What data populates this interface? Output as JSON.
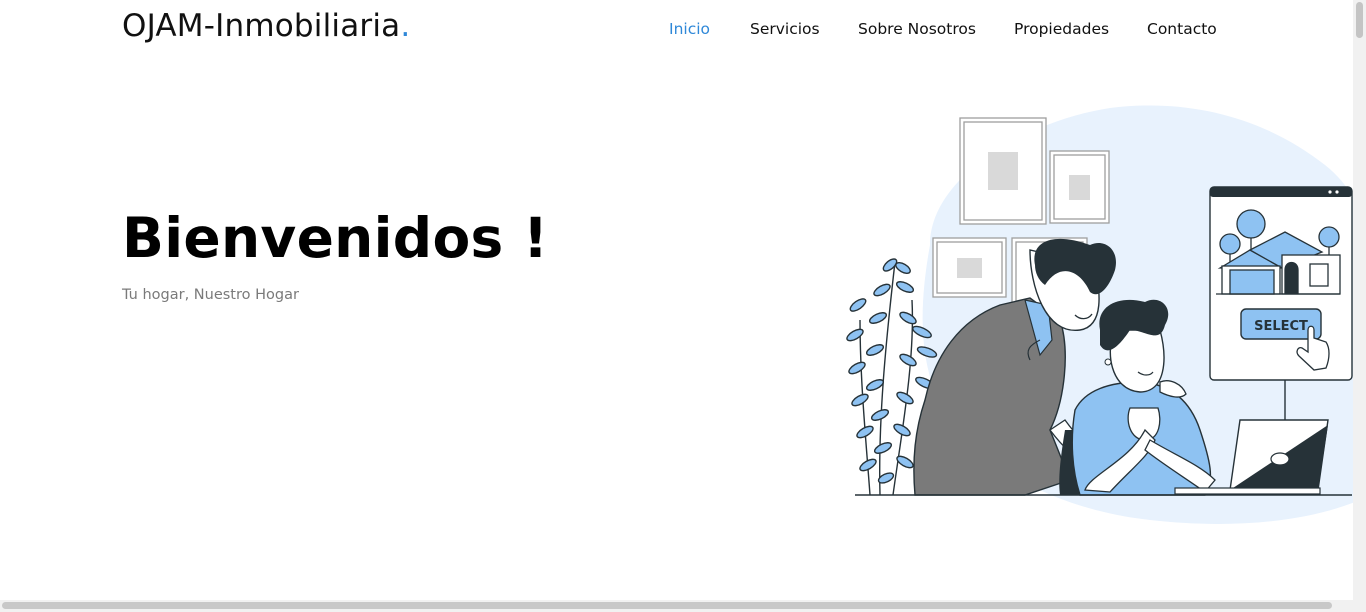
{
  "brand": {
    "name": "OJAM-Inmobiliaria",
    "dot": "."
  },
  "nav": [
    {
      "label": "Inicio",
      "active": true
    },
    {
      "label": "Servicios"
    },
    {
      "label": "Sobre Nosotros"
    },
    {
      "label": "Propiedades"
    },
    {
      "label": "Contacto"
    }
  ],
  "hero": {
    "title": "Bienvenidos !",
    "subtitle": "Tu hogar, Nuestro Hogar",
    "illustration_button_label": "SELECT"
  },
  "colors": {
    "accent": "#2f88d8",
    "illustration_blue": "#8ec2f2",
    "illustration_bg": "#e8f2fd",
    "dark": "#263238"
  }
}
